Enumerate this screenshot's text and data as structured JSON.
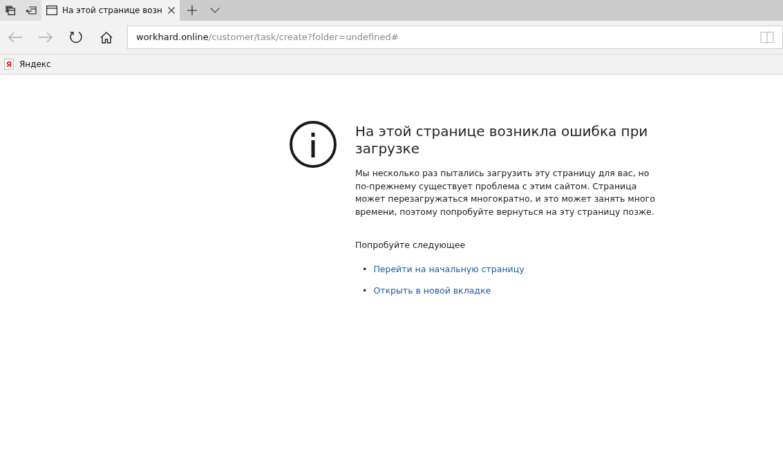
{
  "tabs": [
    {
      "title": "На этой странице возн",
      "selected": true
    }
  ],
  "address": {
    "host": "workhard.online",
    "path": "/customer/task/create?folder=undefined#"
  },
  "favorites": [
    {
      "label": "Яндекс",
      "logo": "Я"
    }
  ],
  "error": {
    "title": "На этой странице возникла ошибка при загрузке",
    "message": "Мы несколько раз пытались загрузить эту страницу для вас, но по-прежнему существует проблема с этим сайтом. Страница может перезагружаться многократно, и это может занять много времени, поэтому попробуйте вернуться на эту страницу позже.",
    "try_heading": "Попробуйте следующее",
    "suggestions": [
      {
        "bullet": "•",
        "label": "Перейти на начальную страницу"
      },
      {
        "bullet": "•",
        "label": "Открыть в новой вкладке"
      }
    ]
  }
}
